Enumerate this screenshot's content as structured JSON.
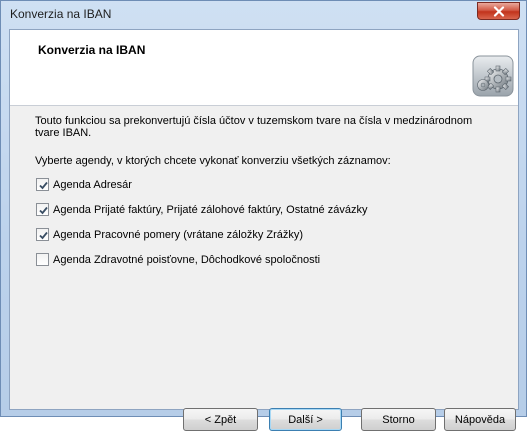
{
  "window": {
    "title": "Konverzia na IBAN"
  },
  "header": {
    "title": "Konverzia na IBAN",
    "icon": "gears-icon"
  },
  "content": {
    "description": "Touto funkciou sa prekonvertujú čísla účtov v tuzemskom tvare na čísla v medzinárodnom tvare IBAN.",
    "prompt": "Vyberte agendy, v ktorých chcete vykonať konverziu všetkých záznamov:",
    "agendas": [
      {
        "label": "Agenda Adresár",
        "checked": true
      },
      {
        "label": "Agenda Prijaté faktúry, Prijaté zálohové faktúry, Ostatné závázky",
        "checked": true
      },
      {
        "label": "Agenda Pracovné pomery (vrátane záložky Zrážky)",
        "checked": true
      },
      {
        "label": "Agenda Zdravotné poisťovne, Dôchodkové spoločnosti",
        "checked": false
      }
    ]
  },
  "buttons": {
    "back": "< Zpět",
    "next": "Další >",
    "cancel": "Storno",
    "help": "Nápověda"
  },
  "colors": {
    "frame": "#bcd2ec",
    "close_button": "#c2331c",
    "default_button_border": "#3c7fb1"
  }
}
